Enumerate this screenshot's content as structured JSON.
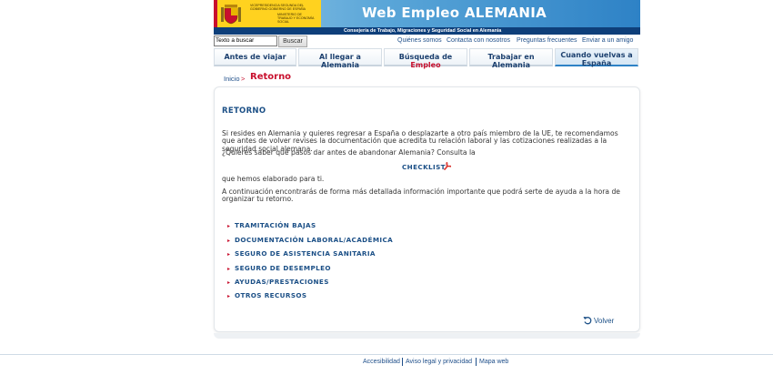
{
  "header": {
    "gov_text_1": "VICEPRESIDENCIA SEGUNDA DEL GOBIERNO GOBIERNO DE ESPAÑA",
    "gov_text_2": "MINISTERIO DE TRABAJO Y ECONOMÍA SOCIAL",
    "site_title": "Web Empleo ALEMANIA",
    "subtitle": "Consejería de Trabajo, Migraciones y Seguridad Social en Alemania",
    "colors": {
      "banner_dark": "#0e3f7a",
      "gov_yellow": "#ffd21f",
      "accent_red": "#c8102e"
    }
  },
  "search": {
    "value": "Texto a buscar",
    "button_label": "Buscar"
  },
  "top_links": [
    "Quiénes somos",
    "Contacta con nosotros",
    "Preguntas frecuentes",
    "Enviar a un amigo"
  ],
  "nav": {
    "tabs": [
      {
        "label": "Antes de viajar"
      },
      {
        "label": "Al llegar a Alemania"
      },
      {
        "label_a": "Búsqueda de ",
        "label_b": "Empleo"
      },
      {
        "label": "Trabajar en Alemania"
      },
      {
        "label": "Cuando vuelvas a España",
        "active": true
      }
    ]
  },
  "breadcrumb": {
    "home": "Inicio",
    "separator": ">",
    "current": "Retorno"
  },
  "content": {
    "heading": "RETORNO",
    "paragraph_1": "Si resides en Alemania y quieres regresar a España o desplazarte a otro país miembro de la UE, te recomendamos que antes de volver revises la documentación que acredita tu relación laboral y las cotizaciones realizadas a la seguridad social alemana.",
    "paragraph_2": "¿Quieres saber qué pasos dar antes de abandonar Alemania? Consulta la",
    "checklist_label": "CHECKLIST",
    "checklist_icon": "pdf-icon",
    "paragraph_3": "que hemos elaborado para ti.",
    "paragraph_4": "A continuación encontrarás de forma más detallada información importante que podrá serte de ayuda a la hora de organizar tu retorno.",
    "sections": [
      "TRAMITACIÓN BAJAS",
      "DOCUMENTACIÓN LABORAL/ACADÉMICA",
      "SEGURO DE ASISTENCIA SANITARIA",
      "SEGURO DE DESEMPLEO",
      "AYUDAS/PRESTACIONES",
      "OTROS RECURSOS"
    ],
    "back_label": "Volver",
    "back_icon": "back-arrow-icon"
  },
  "footer": {
    "links": [
      "Accesibilidad",
      "Aviso legal y privacidad",
      "Mapa web"
    ]
  }
}
